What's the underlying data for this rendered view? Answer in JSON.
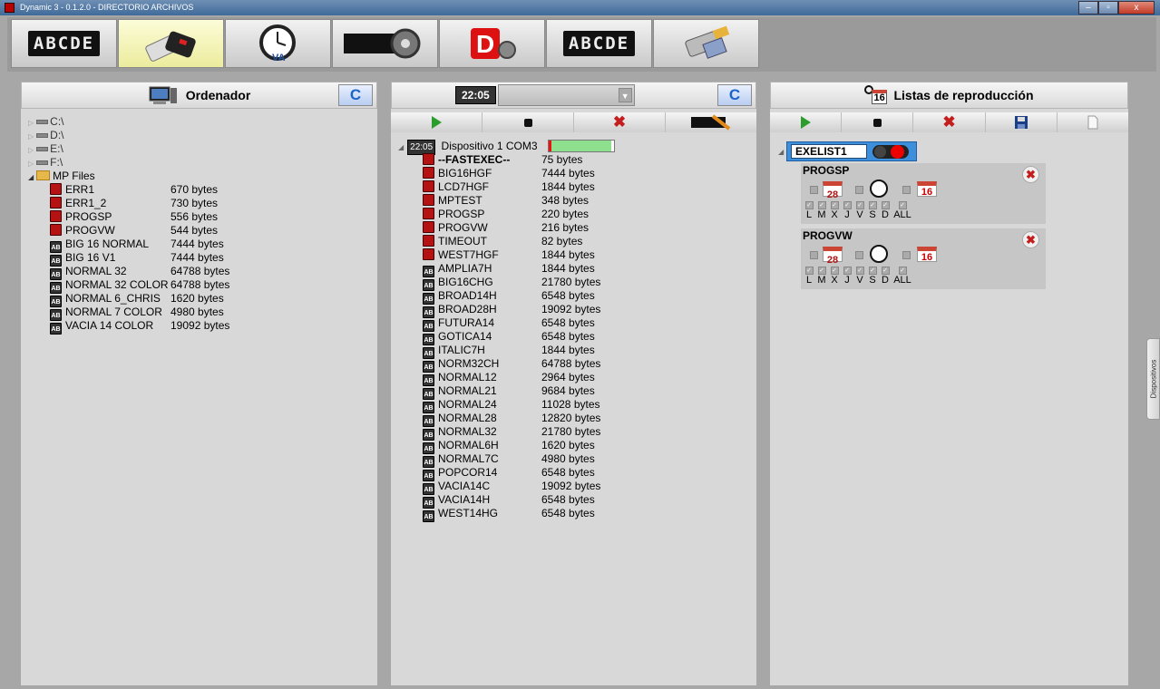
{
  "window": {
    "title": "Dynamic 3 - 0.1.2.0 - DIRECTORIO ARCHIVOS",
    "min": "–",
    "max": "▫",
    "close": "x"
  },
  "toolbar": [
    {
      "id": "abcde",
      "led": "ABCDE"
    },
    {
      "id": "device-transfer",
      "icon": "usb-device-icon"
    },
    {
      "id": "clock",
      "icon": "clock-icon"
    },
    {
      "id": "settings",
      "icon": "gear-icon"
    },
    {
      "id": "dynamic",
      "icon": "logo-d-icon"
    },
    {
      "id": "edit",
      "led": "ABCDE"
    },
    {
      "id": "serial",
      "icon": "serial-connector-icon"
    }
  ],
  "left": {
    "title": "Ordenador",
    "refresh": "C",
    "drives": [
      "C:\\",
      "D:\\",
      "E:\\",
      "F:\\"
    ],
    "folder": "MP Files",
    "files": [
      {
        "kind": "r",
        "name": "ERR1",
        "size": "670 bytes"
      },
      {
        "kind": "r",
        "name": "ERR1_2",
        "size": "730 bytes"
      },
      {
        "kind": "r",
        "name": "PROGSP",
        "size": "556 bytes"
      },
      {
        "kind": "r",
        "name": "PROGVW",
        "size": "544 bytes"
      },
      {
        "kind": "b",
        "name": "BIG 16 NORMAL",
        "size": "7444 bytes"
      },
      {
        "kind": "b",
        "name": "BIG 16 V1",
        "size": "7444 bytes"
      },
      {
        "kind": "b",
        "name": "NORMAL 32",
        "size": "64788 bytes"
      },
      {
        "kind": "b",
        "name": "NORMAL 32 COLOR",
        "size": "64788 bytes"
      },
      {
        "kind": "b",
        "name": "NORMAL 6_CHRIS",
        "size": "1620 bytes"
      },
      {
        "kind": "b",
        "name": "NORMAL 7 COLOR",
        "size": "4980 bytes"
      },
      {
        "kind": "b",
        "name": "VACIA 14 COLOR",
        "size": "19092 bytes"
      }
    ]
  },
  "middle": {
    "clock": "22:05",
    "refresh": "C",
    "device": {
      "clock": "22:05",
      "name": "Dispositivo 1 COM3",
      "progress": 0.96
    },
    "files": [
      {
        "kind": "r",
        "name": "--FASTEXEC--",
        "size": "75 bytes",
        "bold": true
      },
      {
        "kind": "r",
        "name": "BIG16HGF",
        "size": "7444 bytes"
      },
      {
        "kind": "r",
        "name": "LCD7HGF",
        "size": "1844 bytes"
      },
      {
        "kind": "r",
        "name": "MPTEST",
        "size": "348 bytes"
      },
      {
        "kind": "r",
        "name": "PROGSP",
        "size": "220 bytes"
      },
      {
        "kind": "r",
        "name": "PROGVW",
        "size": "216 bytes"
      },
      {
        "kind": "r",
        "name": "TIMEOUT",
        "size": "82 bytes"
      },
      {
        "kind": "r",
        "name": "WEST7HGF",
        "size": "1844 bytes"
      },
      {
        "kind": "b",
        "name": "AMPLIA7H",
        "size": "1844 bytes"
      },
      {
        "kind": "b",
        "name": "BIG16CHG",
        "size": "21780 bytes"
      },
      {
        "kind": "b",
        "name": "BROAD14H",
        "size": "6548 bytes"
      },
      {
        "kind": "b",
        "name": "BROAD28H",
        "size": "19092 bytes"
      },
      {
        "kind": "b",
        "name": "FUTURA14",
        "size": "6548 bytes"
      },
      {
        "kind": "b",
        "name": "GOTICA14",
        "size": "6548 bytes"
      },
      {
        "kind": "b",
        "name": "ITALIC7H",
        "size": "1844 bytes"
      },
      {
        "kind": "b",
        "name": "NORM32CH",
        "size": "64788 bytes"
      },
      {
        "kind": "b",
        "name": "NORMAL12",
        "size": "2964 bytes"
      },
      {
        "kind": "b",
        "name": "NORMAL21",
        "size": "9684 bytes"
      },
      {
        "kind": "b",
        "name": "NORMAL24",
        "size": "11028 bytes"
      },
      {
        "kind": "b",
        "name": "NORMAL28",
        "size": "12820 bytes"
      },
      {
        "kind": "b",
        "name": "NORMAL32",
        "size": "21780 bytes"
      },
      {
        "kind": "b",
        "name": "NORMAL6H",
        "size": "1620 bytes"
      },
      {
        "kind": "b",
        "name": "NORMAL7C",
        "size": "4980 bytes"
      },
      {
        "kind": "b",
        "name": "POPCOR14",
        "size": "6548 bytes"
      },
      {
        "kind": "b",
        "name": "VACIA14C",
        "size": "19092 bytes"
      },
      {
        "kind": "b",
        "name": "VACIA14H",
        "size": "6548 bytes"
      },
      {
        "kind": "b",
        "name": "WEST14HG",
        "size": "6548 bytes"
      }
    ]
  },
  "right": {
    "title": "Listas de reproducción",
    "cal_icon_day": "16",
    "list_name": "EXELIST1",
    "items": [
      {
        "name": "PROGSP",
        "cal_day": "28",
        "cal2_day": "16"
      },
      {
        "name": "PROGVW",
        "cal_day": "28",
        "cal2_day": "16"
      }
    ],
    "days": [
      "L",
      "M",
      "X",
      "J",
      "V",
      "S",
      "D",
      "ALL"
    ]
  },
  "side_tab": "Dispositivos",
  "colors": {
    "accent_blue": "#3d8fdc",
    "red": "#c31d1d",
    "green": "#2c9d2c",
    "progress": "#8ee08e"
  }
}
